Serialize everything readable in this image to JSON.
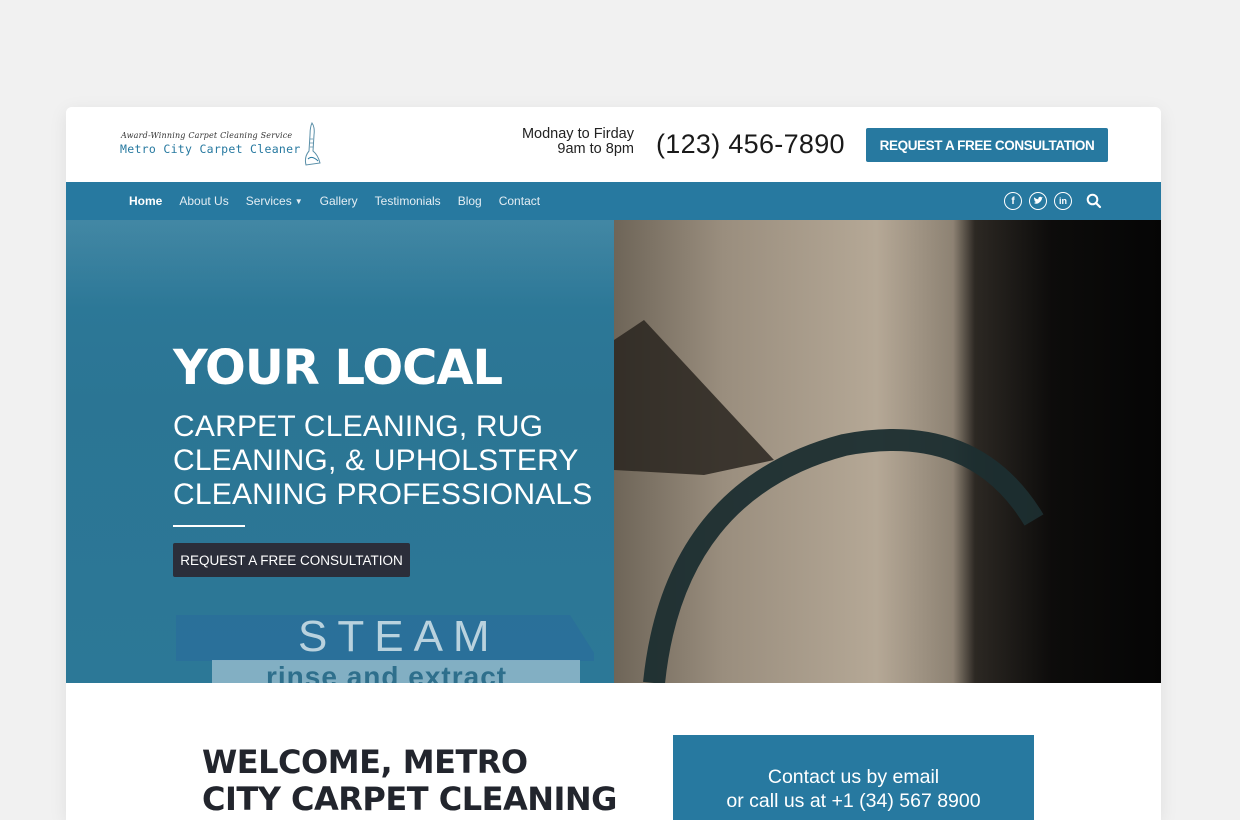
{
  "header": {
    "logo_tagline": "Award-Winning Carpet Cleaning Service",
    "logo_name": "Metro City Carpet Cleaner",
    "hours_line1": "Modnay to Firday",
    "hours_line2": "9am to 8pm",
    "phone": "(123) 456-7890",
    "cta_label": "REQUEST A FREE CONSULTATION"
  },
  "nav": {
    "items": [
      {
        "label": "Home",
        "active": true
      },
      {
        "label": "About Us"
      },
      {
        "label": "Services",
        "has_dropdown": true
      },
      {
        "label": "Gallery"
      },
      {
        "label": "Testimonials"
      },
      {
        "label": "Blog"
      },
      {
        "label": "Contact"
      }
    ],
    "social": [
      "facebook-icon",
      "twitter-icon",
      "linkedin-icon"
    ],
    "search_icon": "search-icon"
  },
  "hero": {
    "title": "YOUR LOCAL",
    "subtitle_line1": "CARPET CLEANING, RUG",
    "subtitle_line2": "CLEANING, & UPHOLSTERY",
    "subtitle_line3": "CLEANING PROFESSIONALS",
    "cta_label": "REQUEST A FREE CONSULTATION",
    "banner_word": "STEAM",
    "banner_sub": "rinse and extract"
  },
  "welcome": {
    "line1": "WELCOME, METRO",
    "line2": "CITY CARPET CLEANING"
  },
  "contact": {
    "line1": "Contact us by email",
    "line2": "or call us at +1 (34) 567 8900"
  },
  "colors": {
    "brand": "#2779a0",
    "dark_button": "#2b2e3a",
    "heading": "#22252d",
    "page_bg": "#f1f1f1"
  }
}
